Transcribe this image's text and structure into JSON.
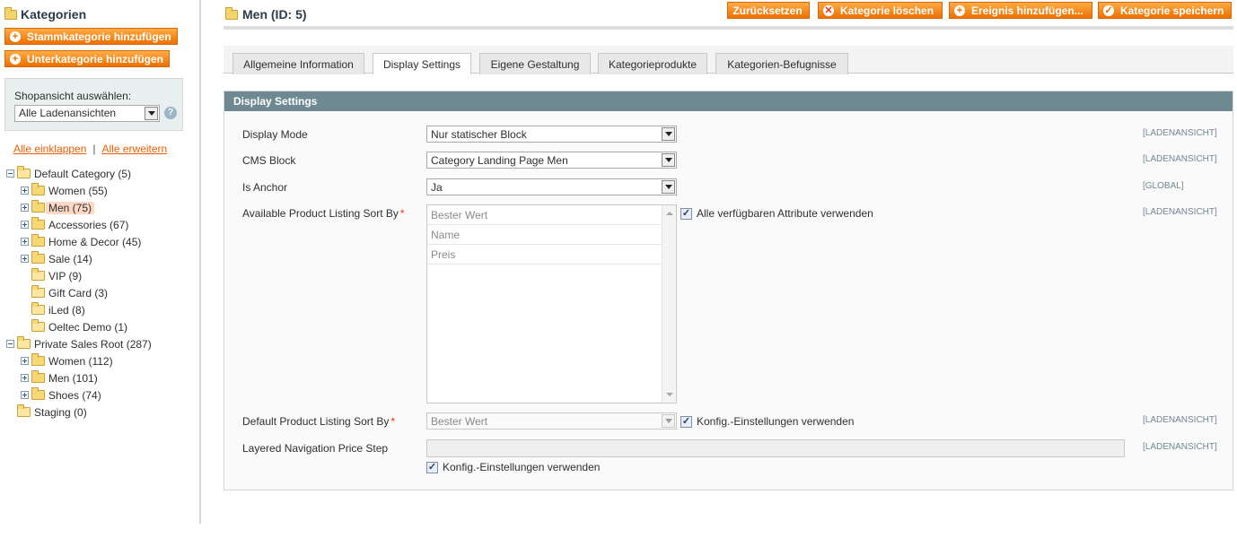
{
  "sidebar": {
    "title": "Kategorien",
    "add_root_label": "Stammkategorie hinzufügen",
    "add_sub_label": "Unterkategorie hinzufügen",
    "store_label": "Shopansicht auswählen:",
    "store_value": "Alle Ladenansichten",
    "collapse_all": "Alle einklappen",
    "link_separator": "|",
    "expand_all": "Alle erweitern",
    "tree": [
      {
        "label": "Default Category (5)",
        "level": 0,
        "toggle": "minus",
        "icon": "folder-open-icon"
      },
      {
        "label": "Women (55)",
        "level": 1,
        "toggle": "plus",
        "icon": "folder-icon"
      },
      {
        "label": "Men (75)",
        "level": 1,
        "toggle": "plus",
        "icon": "folder-icon",
        "selected": true
      },
      {
        "label": "Accessories (67)",
        "level": 1,
        "toggle": "plus",
        "icon": "folder-icon"
      },
      {
        "label": "Home & Decor (45)",
        "level": 1,
        "toggle": "plus",
        "icon": "folder-icon"
      },
      {
        "label": "Sale (14)",
        "level": 1,
        "toggle": "plus",
        "icon": "folder-icon"
      },
      {
        "label": "VIP (9)",
        "level": 1,
        "toggle": "none",
        "icon": "folder-open-icon"
      },
      {
        "label": "Gift Card (3)",
        "level": 1,
        "toggle": "none",
        "icon": "folder-open-icon"
      },
      {
        "label": "iLed (8)",
        "level": 1,
        "toggle": "none",
        "icon": "folder-open-icon"
      },
      {
        "label": "Oeltec Demo (1)",
        "level": 1,
        "toggle": "none",
        "icon": "folder-open-icon"
      },
      {
        "label": "Private Sales Root (287)",
        "level": 0,
        "toggle": "minus",
        "icon": "folder-open-icon"
      },
      {
        "label": "Women (112)",
        "level": 1,
        "toggle": "plus",
        "icon": "folder-icon"
      },
      {
        "label": "Men (101)",
        "level": 1,
        "toggle": "plus",
        "icon": "folder-icon"
      },
      {
        "label": "Shoes (74)",
        "level": 1,
        "toggle": "plus",
        "icon": "folder-icon"
      },
      {
        "label": "Staging (0)",
        "level": 0,
        "toggle": "none",
        "icon": "folder-open-icon"
      }
    ]
  },
  "header": {
    "title": "Men (ID: 5)",
    "reset_label": "Zurücksetzen",
    "delete_label": "Kategorie löschen",
    "add_event_label": "Ereignis hinzufügen...",
    "save_label": "Kategorie speichern"
  },
  "tabs": [
    {
      "label": "Allgemeine Information",
      "active": false
    },
    {
      "label": "Display Settings",
      "active": true
    },
    {
      "label": "Eigene Gestaltung",
      "active": false
    },
    {
      "label": "Kategorieprodukte",
      "active": false
    },
    {
      "label": "Kategorien-Befugnisse",
      "active": false
    }
  ],
  "panel": {
    "title": "Display Settings",
    "fields": {
      "display_mode": {
        "label": "Display Mode",
        "value": "Nur statischer Block",
        "scope": "[LADENANSICHT]"
      },
      "cms_block": {
        "label": "CMS Block",
        "value": "Category Landing Page Men",
        "scope": "[LADENANSICHT]"
      },
      "is_anchor": {
        "label": "Is Anchor",
        "value": "Ja",
        "scope": "[GLOBAL]"
      },
      "available_sort": {
        "label": "Available Product Listing Sort By",
        "required_mark": "*",
        "options": [
          "Bester Wert",
          "Name",
          "Preis"
        ],
        "use_all_label": "Alle verfügbaren Attribute verwenden",
        "use_all_checked": true,
        "scope": "[LADENANSICHT]"
      },
      "default_sort": {
        "label": "Default Product Listing Sort By",
        "required_mark": "*",
        "value": "Bester Wert",
        "use_config_label": "Konfig.-Einstellungen verwenden",
        "use_config_checked": true,
        "scope": "[LADENANSICHT]"
      },
      "price_step": {
        "label": "Layered Navigation Price Step",
        "value": "",
        "use_config_label": "Konfig.-Einstellungen verwenden",
        "use_config_checked": true,
        "scope": "[LADENANSICHT]"
      }
    }
  },
  "colors": {
    "accent_orange": "#f18200",
    "panel_header": "#6f8992",
    "link_orange": "#eb5e00",
    "selected_node": "#fcd8c5"
  }
}
